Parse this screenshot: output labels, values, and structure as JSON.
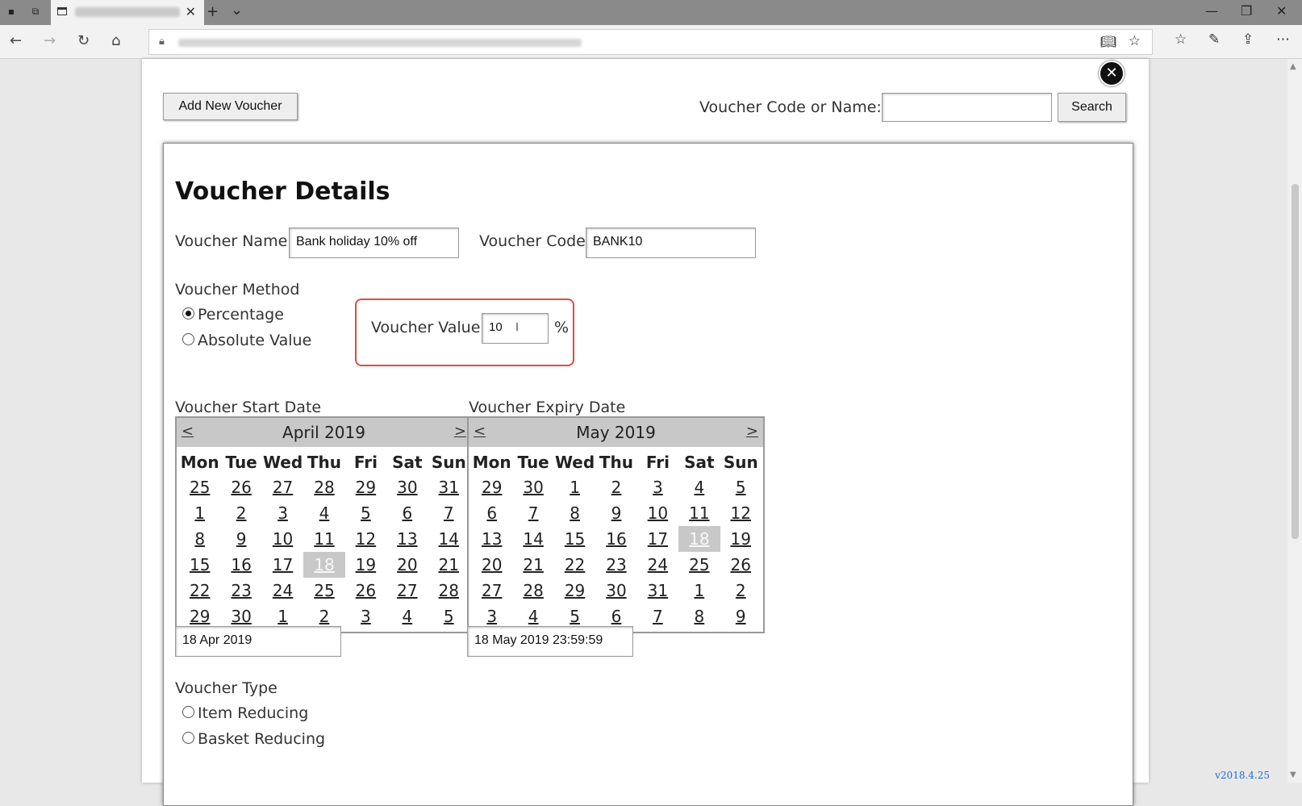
{
  "browser": {
    "window_controls": {
      "minimize": "—",
      "restore": "❐",
      "close": "✕"
    },
    "new_tab": "+",
    "tab_list": "⌄",
    "tab_close": "✕"
  },
  "toolbar": {
    "add_voucher_label": "Add New Voucher",
    "search_label": "Voucher Code or Name:",
    "search_value": "",
    "search_button": "Search",
    "close_glyph": "✕"
  },
  "details": {
    "title": "Voucher Details",
    "name_label": "Voucher Name",
    "name_value": "Bank holiday 10% off",
    "code_label": "Voucher Code",
    "code_value": "BANK10",
    "method_label": "Voucher Method",
    "method_options": [
      "Percentage",
      "Absolute Value"
    ],
    "method_selected": "Percentage",
    "value_label": "Voucher Value",
    "value_value": "10",
    "value_unit": "%",
    "start_label": "Voucher Start Date",
    "expiry_label": "Voucher Expiry Date",
    "start_value": "18 Apr 2019",
    "expiry_value": "18 May 2019 23:59:59",
    "type_label": "Voucher Type",
    "type_options": [
      "Item Reducing",
      "Basket Reducing"
    ]
  },
  "calendars": [
    {
      "month": "April 2019",
      "prev": "<",
      "next": ">",
      "weekdays": [
        "Mon",
        "Tue",
        "Wed",
        "Thu",
        "Fri",
        "Sat",
        "Sun"
      ],
      "selected": "18",
      "weeks": [
        [
          "25",
          "26",
          "27",
          "28",
          "29",
          "30",
          "31"
        ],
        [
          "1",
          "2",
          "3",
          "4",
          "5",
          "6",
          "7"
        ],
        [
          "8",
          "9",
          "10",
          "11",
          "12",
          "13",
          "14"
        ],
        [
          "15",
          "16",
          "17",
          "18",
          "19",
          "20",
          "21"
        ],
        [
          "22",
          "23",
          "24",
          "25",
          "26",
          "27",
          "28"
        ],
        [
          "29",
          "30",
          "1",
          "2",
          "3",
          "4",
          "5"
        ]
      ]
    },
    {
      "month": "May 2019",
      "prev": "<",
      "next": ">",
      "weekdays": [
        "Mon",
        "Tue",
        "Wed",
        "Thu",
        "Fri",
        "Sat",
        "Sun"
      ],
      "selected": "18",
      "weeks": [
        [
          "29",
          "30",
          "1",
          "2",
          "3",
          "4",
          "5"
        ],
        [
          "6",
          "7",
          "8",
          "9",
          "10",
          "11",
          "12"
        ],
        [
          "13",
          "14",
          "15",
          "16",
          "17",
          "18",
          "19"
        ],
        [
          "20",
          "21",
          "22",
          "23",
          "24",
          "25",
          "26"
        ],
        [
          "27",
          "28",
          "29",
          "30",
          "31",
          "1",
          "2"
        ],
        [
          "3",
          "4",
          "5",
          "6",
          "7",
          "8",
          "9"
        ]
      ]
    }
  ],
  "footer": {
    "version": "v2018.4.25"
  },
  "colors": {
    "highlight_border": "#d9503f",
    "selected_day_bg": "#c8c8c8",
    "version_text": "#1a6ed8"
  }
}
